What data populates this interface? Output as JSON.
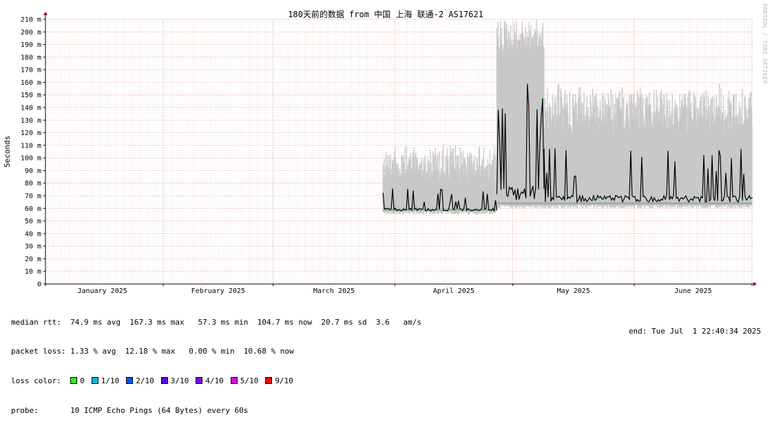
{
  "chart_data": {
    "type": "line",
    "title": "180天前的数据 from 中国 上海 联通-2 AS17621",
    "ylabel": "Seconds",
    "ylim": [
      0,
      210
    ],
    "y_ticks": [
      "0",
      "10 m",
      "20 m",
      "30 m",
      "40 m",
      "50 m",
      "60 m",
      "70 m",
      "80 m",
      "90 m",
      "100 m",
      "110 m",
      "120 m",
      "130 m",
      "140 m",
      "150 m",
      "160 m",
      "170 m",
      "180 m",
      "190 m",
      "200 m",
      "210 m"
    ],
    "x_ticks": [
      "January 2025",
      "February 2025",
      "March 2025",
      "April 2025",
      "May 2025",
      "June 2025"
    ],
    "x_start": "2025-01-02",
    "x_end": "2025-07-01",
    "grid": true,
    "series": [
      {
        "name": "median rtt",
        "segments": [
          {
            "from": "2025-03-29",
            "to": "2025-04-27",
            "median_low": 58,
            "median_high": 76,
            "range_low": 55,
            "range_high": 112
          },
          {
            "from": "2025-04-27",
            "to": "2025-05-09",
            "median_low": 66,
            "median_high": 167,
            "range_low": 60,
            "range_high": 210
          },
          {
            "from": "2025-05-09",
            "to": "2025-07-01",
            "median_low": 65,
            "median_high": 108,
            "range_low": 60,
            "range_high": 160
          }
        ]
      }
    ]
  },
  "stats": {
    "rtt_label": "median rtt:",
    "rtt_values": "74.9 ms avg  167.3 ms max   57.3 ms min  104.7 ms now  20.7 ms sd  3.6   am/s",
    "loss_label": "packet loss:",
    "loss_values": "1.33 % avg  12.18 % max   0.00 % min  10.68 % now",
    "color_label": "loss color:",
    "loss_colors": [
      {
        "label": "0",
        "color": "#26ff00"
      },
      {
        "label": "1/10",
        "color": "#00b8ff"
      },
      {
        "label": "2/10",
        "color": "#0059ff"
      },
      {
        "label": "3/10",
        "color": "#5e00ff"
      },
      {
        "label": "4/10",
        "color": "#7e00ff"
      },
      {
        "label": "5/10",
        "color": "#dd00ff"
      },
      {
        "label": "9/10",
        "color": "#ff0000"
      }
    ],
    "probe_label": "probe:",
    "probe_value": "10 ICMP Echo Pings (64 Bytes) every 60s",
    "end_text": "end: Tue Jul  1 22:40:34 2025"
  },
  "watermark": "RRDTOOL / TOBI OETIKER"
}
